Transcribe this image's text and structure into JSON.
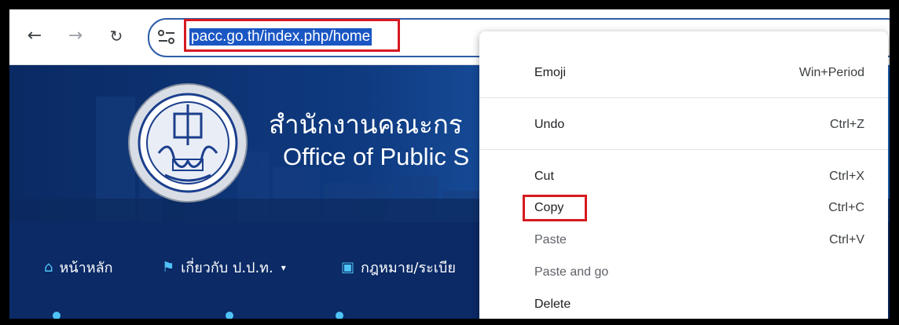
{
  "browser": {
    "url": "pacc.go.th/index.php/home",
    "icons": {
      "back": "arrow-left-icon",
      "forward": "arrow-right-icon",
      "reload": "reload-icon",
      "site_info": "tune-icon"
    },
    "highlight_color": "#d71920"
  },
  "site": {
    "title_th": "สำนักงานคณะกร",
    "title_en": "Office of Public S",
    "nav": [
      {
        "label": "หน้าหลัก",
        "icon": "home-icon"
      },
      {
        "label": "เกี่ยวกับ ป.ป.ท.",
        "icon": "flag-icon",
        "caret": "▾"
      },
      {
        "label": "กฎหมาย/ระเบีย",
        "icon": "money-icon"
      }
    ]
  },
  "context_menu": {
    "items": [
      {
        "label": "Emoji",
        "shortcut": "Win+Period"
      },
      {
        "label": "Undo",
        "shortcut": "Ctrl+Z"
      },
      {
        "label": "Cut",
        "shortcut": "Ctrl+X"
      },
      {
        "label": "Copy",
        "shortcut": "Ctrl+C"
      },
      {
        "label": "Paste",
        "shortcut": "Ctrl+V"
      },
      {
        "label": "Paste and go",
        "shortcut": ""
      },
      {
        "label": "Delete",
        "shortcut": ""
      }
    ]
  }
}
